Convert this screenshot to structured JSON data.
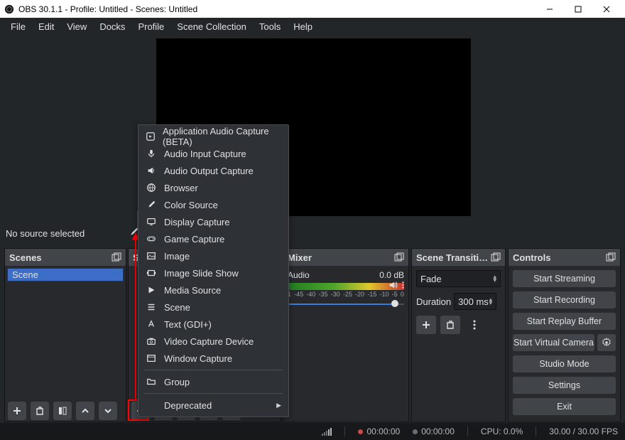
{
  "window": {
    "title": "OBS 30.1.1 - Profile: Untitled - Scenes: Untitled"
  },
  "menubar": [
    "File",
    "Edit",
    "View",
    "Docks",
    "Profile",
    "Scene Collection",
    "Tools",
    "Help"
  ],
  "preview": {
    "no_source_label": "No source selected"
  },
  "scenes": {
    "title": "Scenes",
    "items": [
      "Scene"
    ]
  },
  "sources": {
    "title": "Sources"
  },
  "mixer": {
    "title": "Mixer",
    "channel_name": "Audio",
    "db_label": "0.0 dB",
    "ticks": [
      "1",
      "-45",
      "-40",
      "-35",
      "-30",
      "-25",
      "-20",
      "-15",
      "-10",
      "-5",
      "0"
    ]
  },
  "transitions": {
    "title": "Scene Transiti…",
    "selected": "Fade",
    "duration_label": "Duration",
    "duration_value": "300 ms"
  },
  "controls": {
    "title": "Controls",
    "start_streaming": "Start Streaming",
    "start_recording": "Start Recording",
    "start_replay": "Start Replay Buffer",
    "start_vcam": "Start Virtual Camera",
    "studio_mode": "Studio Mode",
    "settings": "Settings",
    "exit": "Exit"
  },
  "statusbar": {
    "rec_time": "00:00:00",
    "live_time": "00:00:00",
    "cpu": "CPU: 0.0%",
    "fps": "30.00 / 30.00 FPS"
  },
  "context_menu": {
    "items": [
      {
        "icon": "app-audio",
        "label": "Application Audio Capture (BETA)"
      },
      {
        "icon": "mic",
        "label": "Audio Input Capture"
      },
      {
        "icon": "speaker",
        "label": "Audio Output Capture"
      },
      {
        "icon": "globe",
        "label": "Browser"
      },
      {
        "icon": "brush",
        "label": "Color Source"
      },
      {
        "icon": "display",
        "label": "Display Capture"
      },
      {
        "icon": "gamepad",
        "label": "Game Capture"
      },
      {
        "icon": "image",
        "label": "Image"
      },
      {
        "icon": "slideshow",
        "label": "Image Slide Show"
      },
      {
        "icon": "play",
        "label": "Media Source"
      },
      {
        "icon": "list",
        "label": "Scene"
      },
      {
        "icon": "text",
        "label": "Text (GDI+)"
      },
      {
        "icon": "camera",
        "label": "Video Capture Device"
      },
      {
        "icon": "window",
        "label": "Window Capture"
      }
    ],
    "group_label": "Group",
    "deprecated_label": "Deprecated"
  }
}
